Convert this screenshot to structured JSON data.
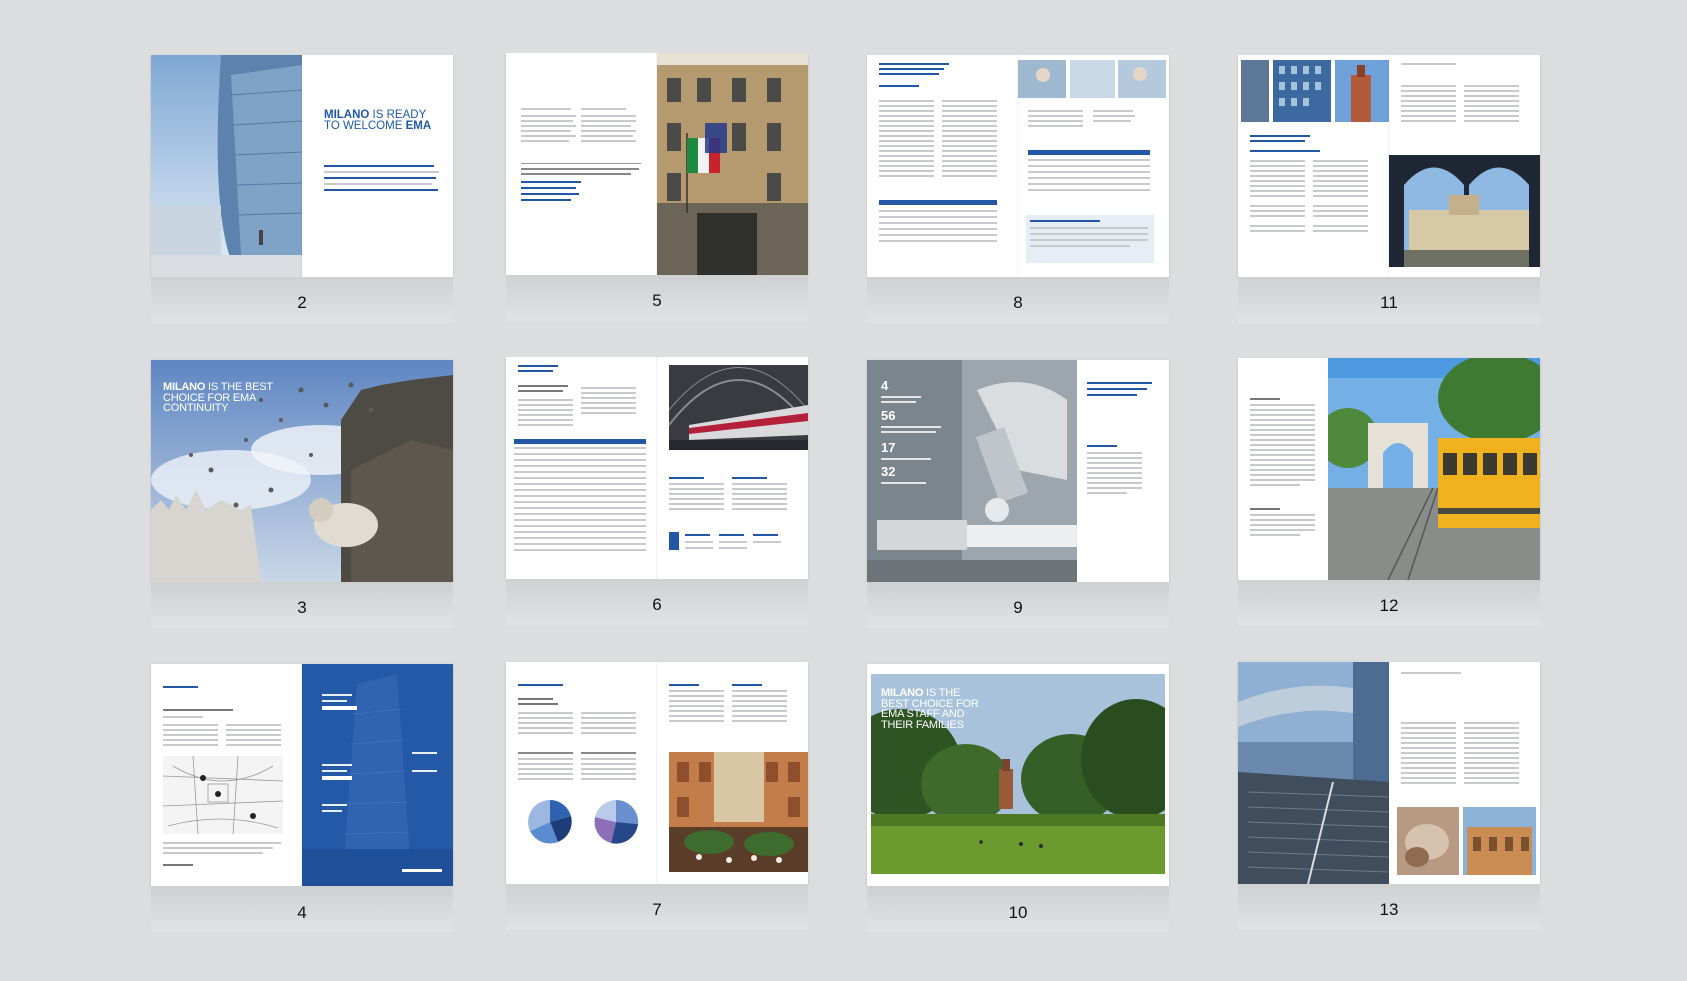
{
  "spreads": [
    {
      "number": "2",
      "headline_a": "MILANO",
      "headline_b": " IS READY",
      "headline_c": "TO WELCOME ",
      "headline_d": "EMA"
    },
    {
      "number": "5"
    },
    {
      "number": "8"
    },
    {
      "number": "11"
    },
    {
      "number": "3",
      "headline_a": "MILANO",
      "headline_b": " IS THE BEST",
      "headline_c": "CHOICE FOR EMA",
      "headline_d": "CONTINUITY"
    },
    {
      "number": "6"
    },
    {
      "number": "9",
      "stat_1": "4",
      "stat_2": "56",
      "stat_3": "17",
      "stat_4": "32"
    },
    {
      "number": "12"
    },
    {
      "number": "4"
    },
    {
      "number": "7"
    },
    {
      "number": "10",
      "headline_a": "MILANO",
      "headline_b": " IS THE",
      "headline_c": "BEST CHOICE FOR",
      "headline_d": "EMA STAFF AND",
      "headline_e": "THEIR FAMILIES"
    },
    {
      "number": "13"
    }
  ],
  "colors": {
    "background": "#dcdddf",
    "accent_blue": "#2456a6",
    "page": "#ffffff"
  }
}
